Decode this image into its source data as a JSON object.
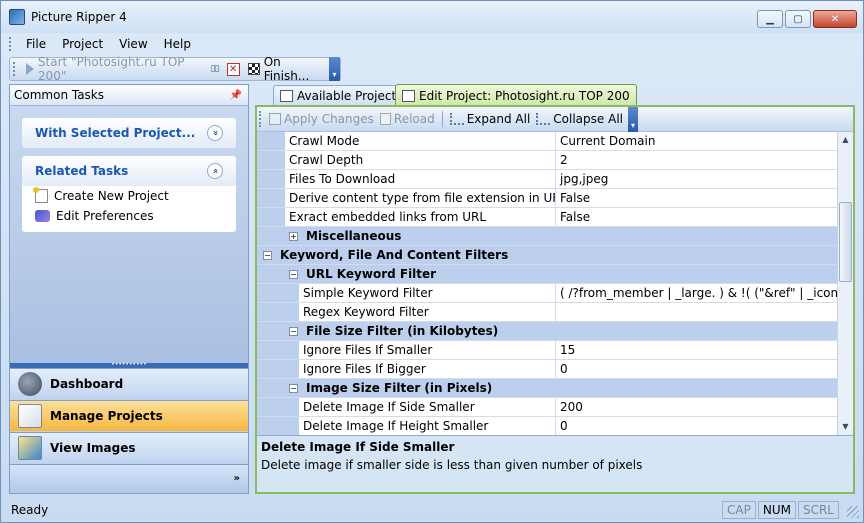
{
  "window": {
    "title": "Picture Ripper 4",
    "minimize": "▁",
    "maximize": "▢",
    "close": "✕"
  },
  "menu": [
    "File",
    "Project",
    "View",
    "Help"
  ],
  "toolbar": {
    "start_label": "Start \"Photosight.ru TOP 200\"",
    "pause_glyph": "▯▯",
    "stop_glyph": "✕",
    "on_finish_label": "On Finish...",
    "overflow_glyph": "▾"
  },
  "left_panel": {
    "title": "Common Tasks",
    "pin_glyph": "📌",
    "with_selected": {
      "title": "With Selected Project...",
      "chevron": "»"
    },
    "related": {
      "title": "Related Tasks",
      "chevron": "«",
      "links": [
        "Create New Project",
        "Edit Preferences"
      ]
    },
    "nav": [
      "Dashboard",
      "Manage Projects",
      "View Images"
    ],
    "nav_active": "Manage Projects",
    "more_glyph": "»"
  },
  "tabs": [
    {
      "label": "Available Projects",
      "active": false
    },
    {
      "label": "Edit Project: Photosight.ru TOP 200",
      "active": true
    }
  ],
  "editor_toolbar": {
    "apply": "Apply Changes",
    "reload": "Reload",
    "expand": "Expand All",
    "collapse": "Collapse All",
    "overflow_glyph": "▾"
  },
  "properties": [
    {
      "name": "Crawl Mode",
      "value": "Current Domain",
      "level": 1
    },
    {
      "name": "Crawl Depth",
      "value": "2",
      "level": 1
    },
    {
      "name": "Files To Download",
      "value": "jpg,jpeg",
      "level": 1
    },
    {
      "name": "Derive content type from file extension in URL",
      "value": "False",
      "level": 1
    },
    {
      "name": "Exract embedded links from URL",
      "value": "False",
      "level": 1
    },
    {
      "category": "Miscellaneous",
      "expander": "+",
      "level": 1
    },
    {
      "category": "Keyword, File And Content Filters",
      "expander": "−",
      "level": 0
    },
    {
      "category": "URL Keyword Filter",
      "expander": "−",
      "level": 1
    },
    {
      "name": "Simple Keyword Filter",
      "value": "( /?from_member | _large. ) & !( (\"&ref\" | _icon.) )",
      "level": 2
    },
    {
      "name": "Regex Keyword Filter",
      "value": "",
      "level": 2
    },
    {
      "category": "File Size Filter (in Kilobytes)",
      "expander": "−",
      "level": 1
    },
    {
      "name": "Ignore Files If Smaller",
      "value": "15",
      "level": 2
    },
    {
      "name": "Ignore Files If Bigger",
      "value": "0",
      "level": 2
    },
    {
      "category": "Image Size Filter (in Pixels)",
      "expander": "−",
      "level": 1
    },
    {
      "name": "Delete Image If Side Smaller",
      "value": "200",
      "level": 2,
      "spinner": true
    },
    {
      "name": "Delete Image If Height Smaller",
      "value": "0",
      "level": 2
    }
  ],
  "description": {
    "title": "Delete Image If Side Smaller",
    "text": "Delete image if smaller side is less than given number of pixels"
  },
  "status": {
    "text": "Ready",
    "indicators": [
      {
        "label": "CAP",
        "on": false
      },
      {
        "label": "NUM",
        "on": true
      },
      {
        "label": "SCRL",
        "on": false
      }
    ]
  },
  "scroll": {
    "up_glyph": "▲",
    "down_glyph": "▼"
  }
}
